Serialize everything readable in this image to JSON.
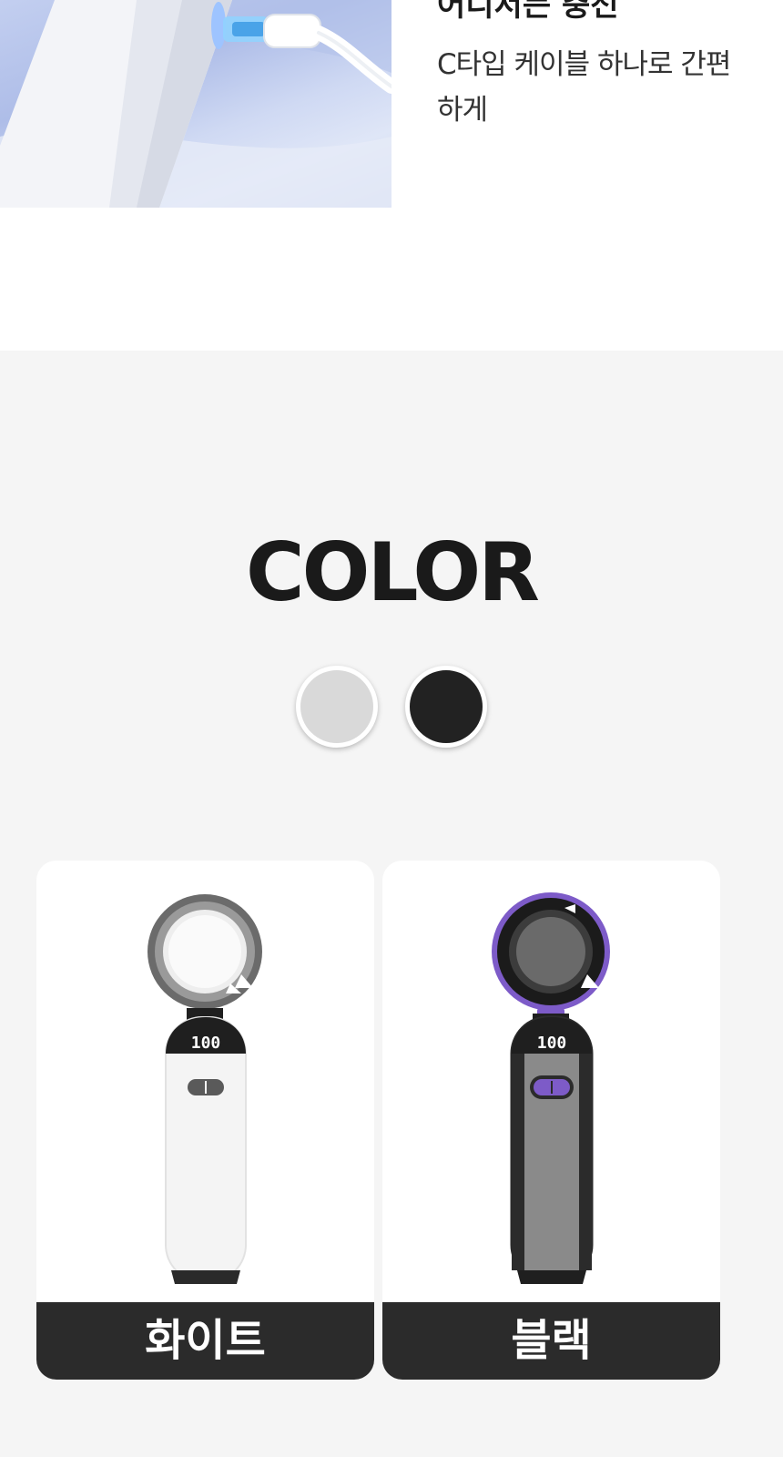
{
  "charging": {
    "heading": "어디서든 충전",
    "description": "C타입 케이블 하나로 간편하게"
  },
  "color_section": {
    "title": "COLOR",
    "swatches": [
      {
        "name": "white",
        "color": "#d9d9d9"
      },
      {
        "name": "black",
        "color": "#222222"
      }
    ],
    "products": [
      {
        "label": "화이트",
        "display": "100",
        "body_color": "#f4f4f4",
        "accent": "#555555"
      },
      {
        "label": "블랙",
        "display": "100",
        "body_color": "#8a8a8a",
        "accent": "#7d5bc8"
      }
    ]
  }
}
